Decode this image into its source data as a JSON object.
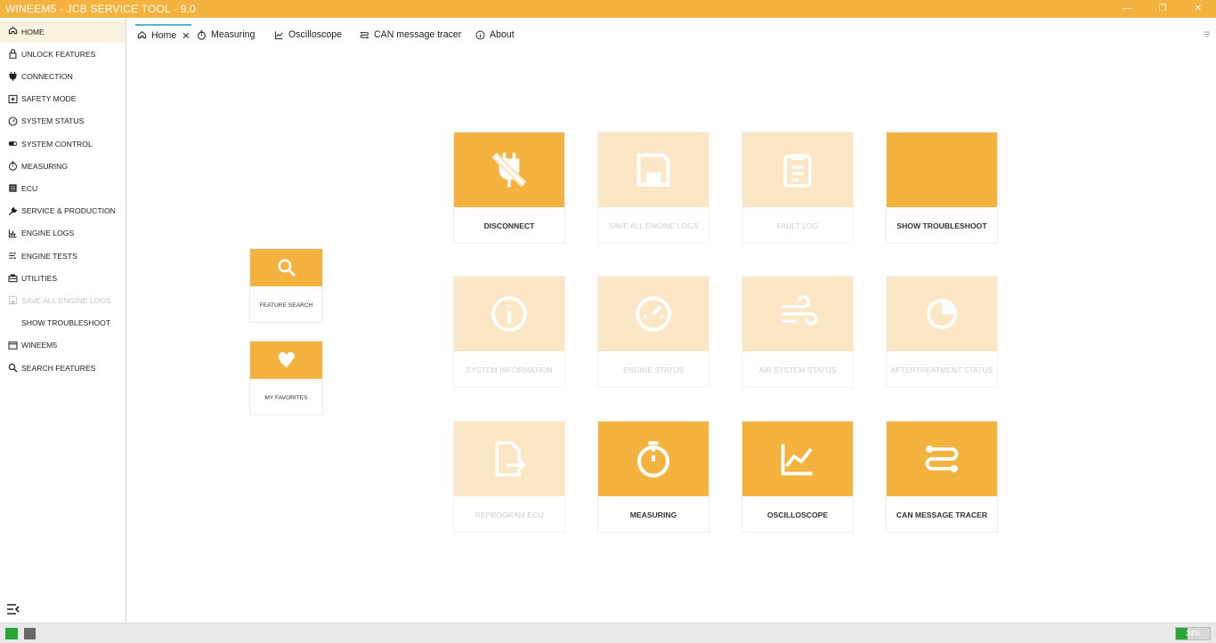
{
  "window": {
    "title": "WINEEM5 - JCB SERVICE TOOL - 9.0"
  },
  "sidebar": {
    "items": [
      {
        "label": "HOME",
        "icon": "home-icon",
        "active": true,
        "disabled": false
      },
      {
        "label": "UNLOCK FEATURES",
        "icon": "lock-icon",
        "active": false,
        "disabled": false
      },
      {
        "label": "CONNECTION",
        "icon": "plug-icon",
        "active": false,
        "disabled": false
      },
      {
        "label": "SAFETY MODE",
        "icon": "plus-box-icon",
        "active": false,
        "disabled": false
      },
      {
        "label": "SYSTEM STATUS",
        "icon": "gauge-icon",
        "active": false,
        "disabled": false
      },
      {
        "label": "SYSTEM CONTROL",
        "icon": "toggle-icon",
        "active": false,
        "disabled": false
      },
      {
        "label": "MEASURING",
        "icon": "stopwatch-icon",
        "active": false,
        "disabled": false
      },
      {
        "label": "ECU",
        "icon": "chip-icon",
        "active": false,
        "disabled": false
      },
      {
        "label": "SERVICE & PRODUCTION",
        "icon": "wrench-icon",
        "active": false,
        "disabled": false
      },
      {
        "label": "ENGINE LOGS",
        "icon": "bar-chart-icon",
        "active": false,
        "disabled": false
      },
      {
        "label": "ENGINE TESTS",
        "icon": "tests-icon",
        "active": false,
        "disabled": false
      },
      {
        "label": "UTILITIES",
        "icon": "toolbox-icon",
        "active": false,
        "disabled": false
      },
      {
        "label": "SAVE ALL ENGINE LOGS",
        "icon": "save-icon",
        "active": false,
        "disabled": true
      },
      {
        "label": "SHOW TROUBLESHOOT",
        "icon": "book-icon",
        "active": false,
        "disabled": false
      },
      {
        "label": "WINEEM5",
        "icon": "window-icon",
        "active": false,
        "disabled": false
      },
      {
        "label": "SEARCH FEATURES",
        "icon": "search-icon",
        "active": false,
        "disabled": false
      }
    ]
  },
  "tabs": [
    {
      "label": "Home",
      "icon": "home-icon",
      "active": true,
      "closable": true
    },
    {
      "label": "Measuring",
      "icon": "stopwatch-icon",
      "active": false,
      "closable": false
    },
    {
      "label": "Oscilloscope",
      "icon": "line-chart-icon",
      "active": false,
      "closable": false
    },
    {
      "label": "CAN message tracer",
      "icon": "tracer-icon",
      "active": false,
      "closable": false
    },
    {
      "label": "About",
      "icon": "info-icon",
      "active": false,
      "closable": false
    }
  ],
  "side_tiles": [
    {
      "label": "FEATURE SEARCH",
      "icon": "search-icon"
    },
    {
      "label": "MY FAVORITES",
      "icon": "heart-icon"
    }
  ],
  "tiles": [
    {
      "label": "DISCONNECT",
      "icon": "unplug-icon",
      "enabled": true
    },
    {
      "label": "SAVE ALL ENGINE LOGS",
      "icon": "save-icon",
      "enabled": false
    },
    {
      "label": "FAULT LOG",
      "icon": "clipboard-icon",
      "enabled": false
    },
    {
      "label": "SHOW TROUBLESHOOT",
      "icon": "book-icon",
      "enabled": true
    },
    {
      "label": "SYSTEM INFORMATION",
      "icon": "info-icon",
      "enabled": false
    },
    {
      "label": "ENGINE STATUS",
      "icon": "gauge-icon",
      "enabled": false
    },
    {
      "label": "AIR SYSTEM STATUS",
      "icon": "wind-icon",
      "enabled": false
    },
    {
      "label": "AFTERTREATMENT STATUS",
      "icon": "aftertreatment-icon",
      "enabled": false
    },
    {
      "label": "REPROGRAM ECU",
      "icon": "file-arrow-icon",
      "enabled": false
    },
    {
      "label": "MEASURING",
      "icon": "stopwatch-icon",
      "enabled": true
    },
    {
      "label": "OSCILLOSCOPE",
      "icon": "line-chart-icon",
      "enabled": true
    },
    {
      "label": "CAN MESSAGE TRACER",
      "icon": "tracer-icon",
      "enabled": true
    }
  ],
  "status": {
    "progress_text": "34%",
    "progress_fraction": 0.34
  },
  "colors": {
    "accent": "#f4b23e",
    "accent_disabled": "#fbe6c5",
    "tab_indicator": "#5ab3d8",
    "status_green": "#2aa636"
  }
}
